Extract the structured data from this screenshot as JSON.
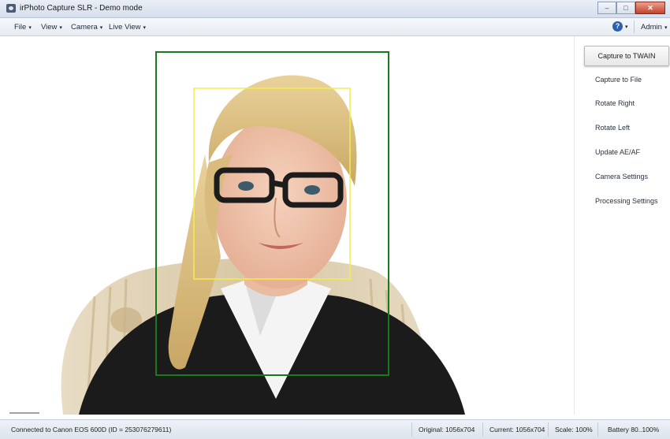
{
  "window": {
    "title": "irPhoto Capture SLR - Demo mode"
  },
  "menu": {
    "file": "File",
    "view": "View",
    "camera": "Camera",
    "live_view": "Live View",
    "admin": "Admin"
  },
  "actions": {
    "capture_twain": "Capture to TWAIN",
    "capture_file": "Capture to File",
    "rotate_right": "Rotate Right",
    "rotate_left": "Rotate Left",
    "update_ae": "Update AE/AF",
    "camera_settings": "Camera Settings",
    "processing_settings": "Processing Settings"
  },
  "status": {
    "connection": "Connected to Canon EOS 600D (ID = 253076279611)",
    "original": "Original: 1056x704",
    "current": "Current: 1056x704",
    "scale": "Scale: 100%",
    "battery": "Battery 80..100%"
  },
  "colors": {
    "face_frame": "#1a7a1a",
    "face_detect": "#f2ee4a",
    "help_icon": "#2c5fb3"
  }
}
